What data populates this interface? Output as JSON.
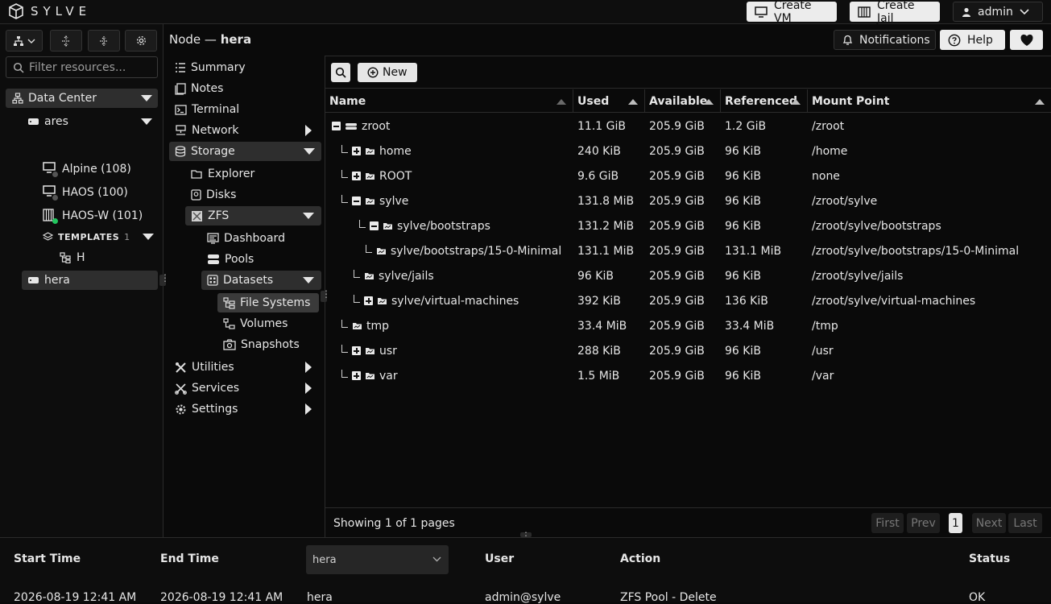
{
  "app": {
    "brand": "SYLVE"
  },
  "topbar": {
    "create_vm": "Create VM",
    "create_jail": "Create Jail",
    "user": "admin"
  },
  "header": {
    "prefix": "Node —",
    "node": "hera",
    "notifications": "Notifications",
    "help": "Help"
  },
  "left": {
    "filter_placeholder": "Filter resources...",
    "datacenter": "Data Center",
    "host1": "ares",
    "vms": [
      {
        "label": "Alpine (108)",
        "status": "#555555"
      },
      {
        "label": "HAOS (100)",
        "status": "#555555"
      },
      {
        "label": "HAOS-W (101)",
        "status": "#22c55e"
      }
    ],
    "templates_label": "TEMPLATES",
    "templates_count": "1",
    "template_item": "H",
    "host2": "hera"
  },
  "menu": {
    "summary": "Summary",
    "notes": "Notes",
    "terminal": "Terminal",
    "network": "Network",
    "storage": "Storage",
    "explorer": "Explorer",
    "disks": "Disks",
    "zfs": "ZFS",
    "dashboard": "Dashboard",
    "pools": "Pools",
    "datasets": "Datasets",
    "file_systems": "File Systems",
    "volumes": "Volumes",
    "snapshots": "Snapshots",
    "utilities": "Utilities",
    "services": "Services",
    "settings": "Settings"
  },
  "toolbar": {
    "new_label": "New"
  },
  "table": {
    "headers": {
      "name": "Name",
      "used": "Used",
      "available": "Available",
      "referenced": "Referenced",
      "mount": "Mount Point"
    },
    "rows": [
      {
        "name": "zroot",
        "used": "11.1 GiB",
        "avail": "205.9 GiB",
        "ref": "1.2 GiB",
        "mount": "/zroot"
      },
      {
        "name": "home",
        "used": "240 KiB",
        "avail": "205.9 GiB",
        "ref": "96 KiB",
        "mount": "/home"
      },
      {
        "name": "ROOT",
        "used": "9.6 GiB",
        "avail": "205.9 GiB",
        "ref": "96 KiB",
        "mount": "none"
      },
      {
        "name": "sylve",
        "used": "131.8 MiB",
        "avail": "205.9 GiB",
        "ref": "96 KiB",
        "mount": "/zroot/sylve"
      },
      {
        "name": "sylve/bootstraps",
        "used": "131.2 MiB",
        "avail": "205.9 GiB",
        "ref": "96 KiB",
        "mount": "/zroot/sylve/bootstraps"
      },
      {
        "name": "sylve/bootstraps/15-0-Minimal",
        "used": "131.1 MiB",
        "avail": "205.9 GiB",
        "ref": "131.1 MiB",
        "mount": "/zroot/sylve/bootstraps/15-0-Minimal"
      },
      {
        "name": "sylve/jails",
        "used": "96 KiB",
        "avail": "205.9 GiB",
        "ref": "96 KiB",
        "mount": "/zroot/sylve/jails"
      },
      {
        "name": "sylve/virtual-machines",
        "used": "392 KiB",
        "avail": "205.9 GiB",
        "ref": "136 KiB",
        "mount": "/zroot/sylve/virtual-machines"
      },
      {
        "name": "tmp",
        "used": "33.4 MiB",
        "avail": "205.9 GiB",
        "ref": "33.4 MiB",
        "mount": "/tmp"
      },
      {
        "name": "usr",
        "used": "288 KiB",
        "avail": "205.9 GiB",
        "ref": "96 KiB",
        "mount": "/usr"
      },
      {
        "name": "var",
        "used": "1.5 MiB",
        "avail": "205.9 GiB",
        "ref": "96 KiB",
        "mount": "/var"
      }
    ]
  },
  "pager": {
    "showing": "Showing 1 of 1 pages",
    "first": "First",
    "prev": "Prev",
    "page": "1",
    "next": "Next",
    "last": "Last"
  },
  "tasks": {
    "headers": {
      "start": "Start Time",
      "end": "End Time",
      "user": "User",
      "action": "Action",
      "status": "Status"
    },
    "node_filter": "hera",
    "row": {
      "start": "2026-08-19 12:41 AM",
      "end": "2026-08-19 12:41 AM",
      "node": "hera",
      "user": "admin@sylve",
      "action": "ZFS Pool - Delete",
      "status": "OK"
    }
  }
}
